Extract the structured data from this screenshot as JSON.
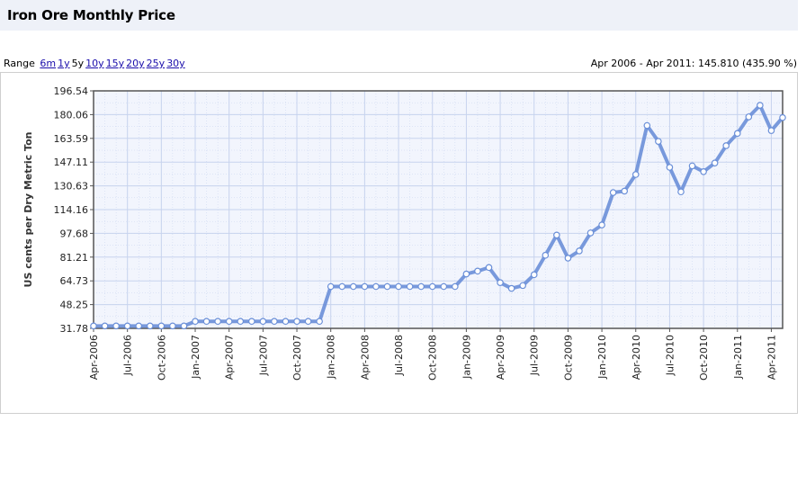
{
  "page": {
    "title": "Iron Ore Monthly Price",
    "range_label": "Range",
    "range_options": [
      {
        "label": "6m",
        "active": false
      },
      {
        "label": "1y",
        "active": false
      },
      {
        "label": "5y",
        "active": true
      },
      {
        "label": "10y",
        "active": false
      },
      {
        "label": "15y",
        "active": false
      },
      {
        "label": "20y",
        "active": false
      },
      {
        "label": "25y",
        "active": false
      },
      {
        "label": "30y",
        "active": false
      }
    ],
    "summary": "Apr 2006 - Apr 2011: 145.810 (435.90 %)"
  },
  "colors": {
    "line": "#6a8fd8",
    "plot_bg": "#f2f5fd",
    "grid": "#c7d3ee",
    "axis": "#555555"
  },
  "chart_data": {
    "type": "line",
    "title": "Iron Ore Monthly Price",
    "ylabel": "US cents per Dry Metric Ton",
    "xlabel": "",
    "ylim": [
      31.78,
      196.54
    ],
    "y_ticks": [
      "31.78",
      "48.25",
      "64.73",
      "81.21",
      "97.68",
      "114.16",
      "130.63",
      "147.11",
      "163.59",
      "180.06",
      "196.54"
    ],
    "x_ticks": [
      "Apr-2006",
      "Jul-2006",
      "Oct-2006",
      "Jan-2007",
      "Apr-2007",
      "Jul-2007",
      "Oct-2007",
      "Jan-2008",
      "Apr-2008",
      "Jul-2008",
      "Oct-2008",
      "Jan-2009",
      "Apr-2009",
      "Jul-2009",
      "Oct-2009",
      "Jan-2010",
      "Apr-2010",
      "Jul-2010",
      "Oct-2010",
      "Jan-2011",
      "Apr-2011"
    ],
    "grid": true,
    "legend": "none",
    "series": [
      {
        "values": [
          33.45,
          33.45,
          33.45,
          33.45,
          33.45,
          33.45,
          33.45,
          33.45,
          33.45,
          36.63,
          36.63,
          36.63,
          36.63,
          36.63,
          36.63,
          36.63,
          36.63,
          36.63,
          36.63,
          36.63,
          36.63,
          60.8,
          60.8,
          60.8,
          60.8,
          60.8,
          60.8,
          60.8,
          60.8,
          60.8,
          60.8,
          60.8,
          60.8,
          69.5,
          71.5,
          74.0,
          63.5,
          59.5,
          61.5,
          69.0,
          82.5,
          96.5,
          80.5,
          85.5,
          98.0,
          103.5,
          126.0,
          127.0,
          138.5,
          172.5,
          161.5,
          143.5,
          126.5,
          144.5,
          140.5,
          146.5,
          158.5,
          167.0,
          178.5,
          186.5,
          169.0,
          178.0
        ]
      }
    ]
  }
}
